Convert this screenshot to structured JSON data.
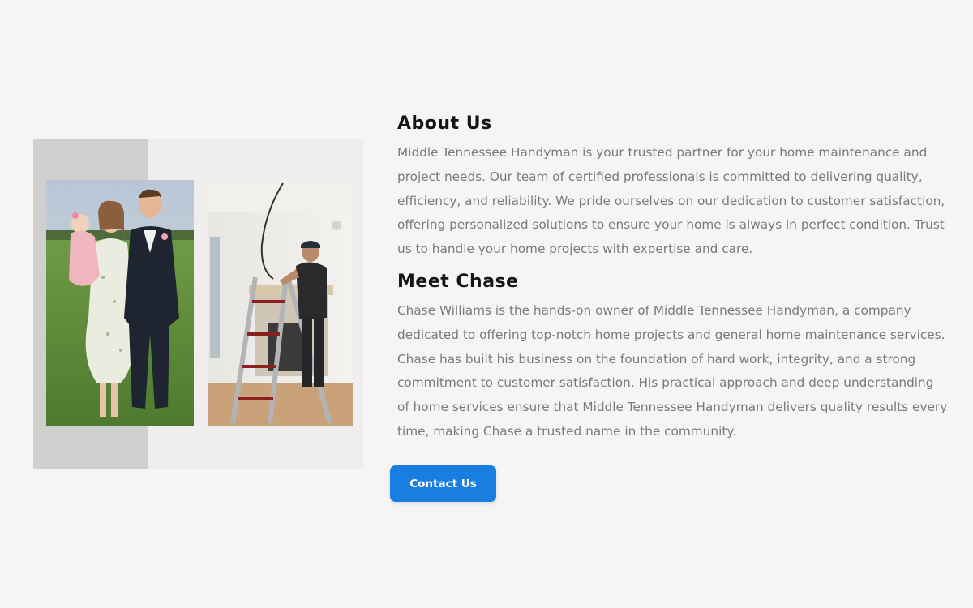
{
  "about": {
    "title": "About Us",
    "body": "Middle Tennessee Handyman is your trusted partner for your home maintenance and project needs. Our team of certified professionals is committed to delivering quality, efficiency, and reliability. We pride ourselves on our dedication to customer satisfaction, offering personalized solutions to ensure your home is always in perfect condition. Trust us to handle your home projects with expertise and care."
  },
  "owner": {
    "title": "Meet Chase",
    "body": "Chase Williams is the hands-on owner of Middle Tennessee Handyman, a company dedicated to offering top-notch home projects and general home maintenance services. Chase has built his business on the foundation of hard work, integrity, and a strong commitment to customer satisfaction. His practical approach and deep understanding of home services ensure that Middle Tennessee Handyman delivers quality results every time, making Chase a trusted name in the community."
  },
  "cta": {
    "label": "Contact Us"
  },
  "colors": {
    "background": "#f6f5f3",
    "accent_button": "#1a7ee0",
    "heading_text": "#151515",
    "body_text": "#7a7a7a"
  }
}
